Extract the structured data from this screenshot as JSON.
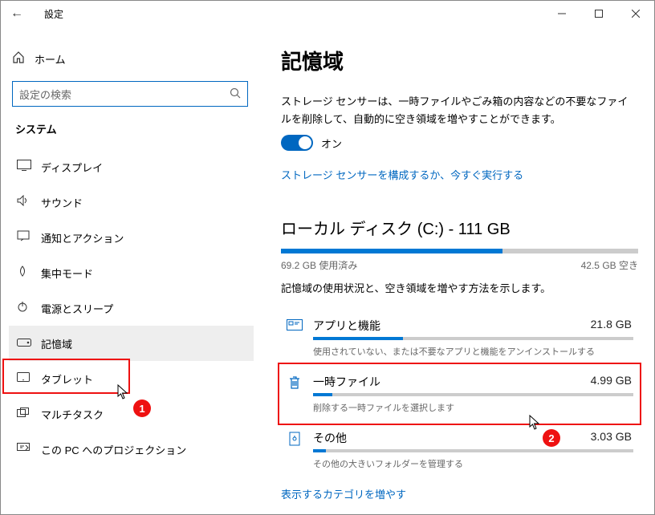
{
  "window": {
    "title": "設定",
    "minimize": "—",
    "maximize": "▢",
    "close": "✕"
  },
  "sidebar": {
    "home": "ホーム",
    "search_placeholder": "設定の検索",
    "section": "システム",
    "items": [
      {
        "icon": "display",
        "label": "ディスプレイ"
      },
      {
        "icon": "sound",
        "label": "サウンド"
      },
      {
        "icon": "notify",
        "label": "通知とアクション"
      },
      {
        "icon": "focus",
        "label": "集中モード"
      },
      {
        "icon": "power",
        "label": "電源とスリープ"
      },
      {
        "icon": "storage",
        "label": "記憶域"
      },
      {
        "icon": "tablet",
        "label": "タブレット"
      },
      {
        "icon": "multitask",
        "label": "マルチタスク"
      },
      {
        "icon": "project",
        "label": "この PC へのプロジェクション"
      }
    ]
  },
  "content": {
    "heading": "記憶域",
    "sense_desc": "ストレージ センサーは、一時ファイルやごみ箱の内容などの不要なファイルを削除して、自動的に空き領域を増やすことができます。",
    "toggle_label": "オン",
    "toggle_on": true,
    "sense_link": "ストレージ センサーを構成するか、今すぐ実行する",
    "disk_heading": "ローカル ディスク (C:) - 111 GB",
    "disk_used_pct": 62,
    "disk_used": "69.2 GB 使用済み",
    "disk_free": "42.5 GB 空き",
    "disk_hint": "記憶域の使用状況と、空き領域を増やす方法を示します。",
    "items": [
      {
        "icon": "apps",
        "title": "アプリと機能",
        "size": "21.8 GB",
        "pct": 28,
        "sub": "使用されていない、または不要なアプリと機能をアンインストールする"
      },
      {
        "icon": "trash",
        "title": "一時ファイル",
        "size": "4.99 GB",
        "pct": 6,
        "sub": "削除する一時ファイルを選択します"
      },
      {
        "icon": "other",
        "title": "その他",
        "size": "3.03 GB",
        "pct": 4,
        "sub": "その他の大きいフォルダーを管理する"
      }
    ],
    "more_link": "表示するカテゴリを増やす"
  },
  "annotations": {
    "badge1": "1",
    "badge2": "2"
  }
}
